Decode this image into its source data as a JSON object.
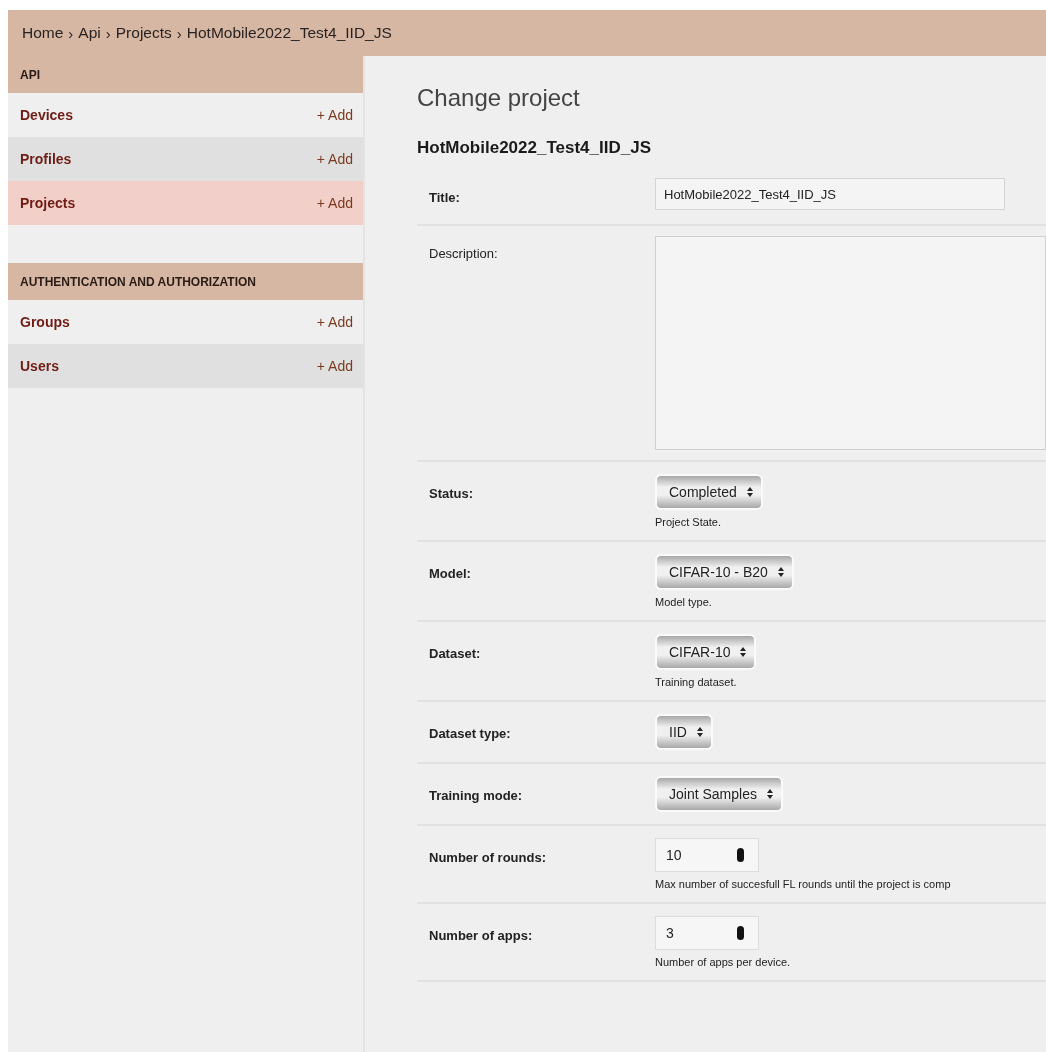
{
  "breadcrumbs": [
    "Home",
    "Api",
    "Projects",
    "HotMobile2022_Test4_IID_JS"
  ],
  "breadcrumb_separator": "›",
  "sidebar": {
    "sections": [
      {
        "title": "API",
        "items": [
          {
            "label": "Devices",
            "add": "+ Add",
            "selected": false
          },
          {
            "label": "Profiles",
            "add": "+ Add",
            "selected": false
          },
          {
            "label": "Projects",
            "add": "+ Add",
            "selected": true
          }
        ]
      },
      {
        "title": "AUTHENTICATION AND AUTHORIZATION",
        "items": [
          {
            "label": "Groups",
            "add": "+ Add",
            "selected": false
          },
          {
            "label": "Users",
            "add": "+ Add",
            "selected": false
          }
        ]
      }
    ]
  },
  "heading": "Change project",
  "object_name": "HotMobile2022_Test4_IID_JS",
  "fields": [
    {
      "kind": "text",
      "label": "Title:",
      "required": true,
      "value": "HotMobile2022_Test4_IID_JS"
    },
    {
      "kind": "textarea",
      "label": "Description:",
      "required": false
    },
    {
      "kind": "select",
      "label": "Status:",
      "required": true,
      "value": "Completed",
      "help": "Project State."
    },
    {
      "kind": "select",
      "label": "Model:",
      "required": true,
      "value": "CIFAR-10 - B20",
      "help": "Model type."
    },
    {
      "kind": "select",
      "label": "Dataset:",
      "required": true,
      "value": "CIFAR-10",
      "help": "Training dataset."
    },
    {
      "kind": "select",
      "label": "Dataset type:",
      "required": true,
      "value": "IID"
    },
    {
      "kind": "select",
      "label": "Training mode:",
      "required": true,
      "value": "Joint Samples"
    },
    {
      "kind": "number",
      "label": "Number of rounds:",
      "required": true,
      "value": "10",
      "help": "Max number of succesfull FL rounds until the project is comp"
    },
    {
      "kind": "number",
      "label": "Number of apps:",
      "required": true,
      "value": "3",
      "help": "Number of apps per device."
    }
  ]
}
